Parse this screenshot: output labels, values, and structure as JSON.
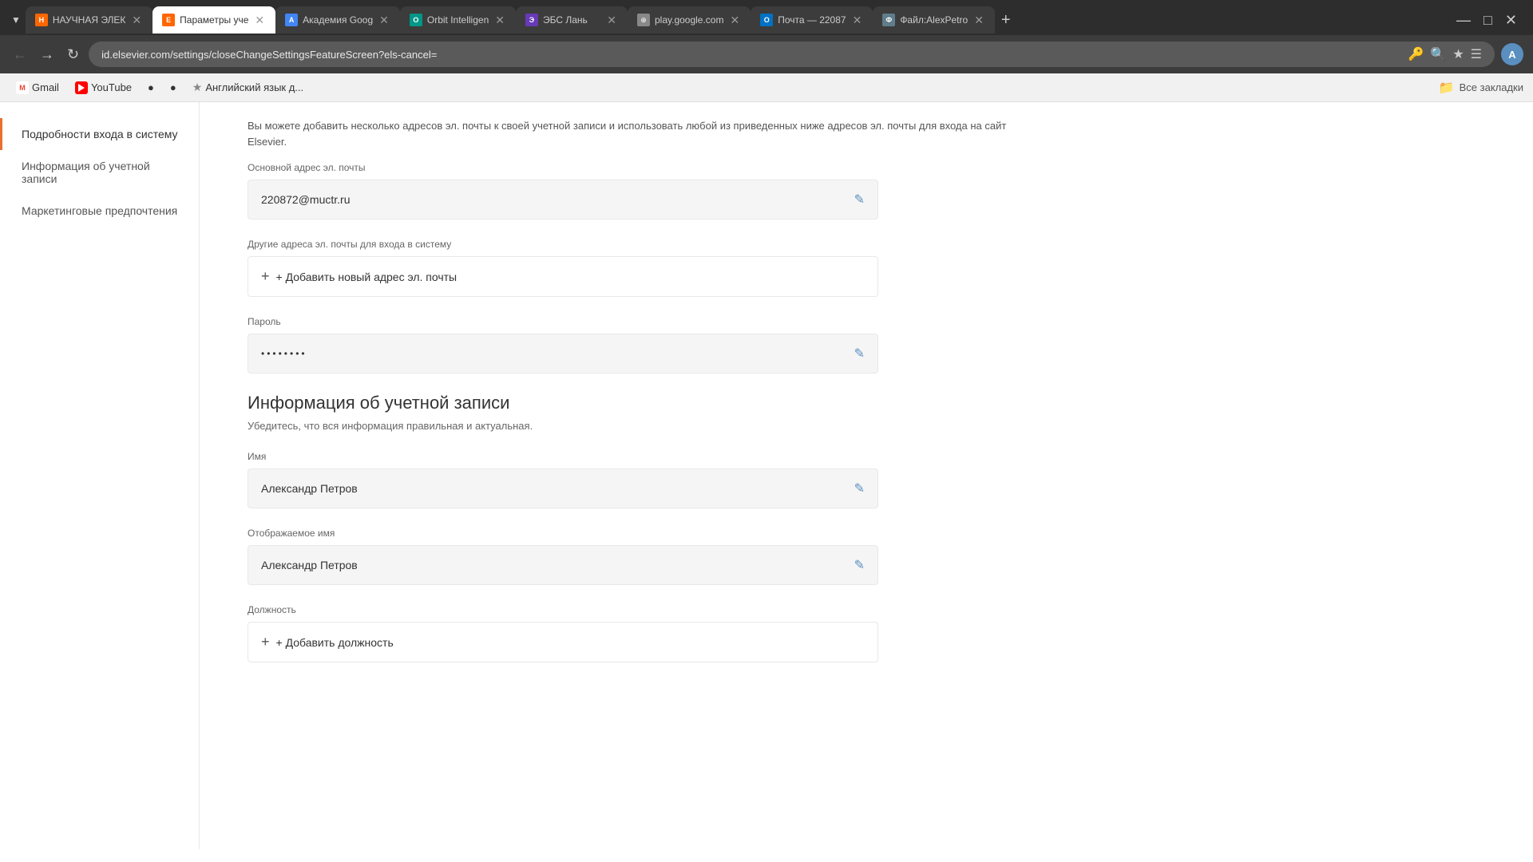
{
  "browser": {
    "tabs": [
      {
        "id": "tab1",
        "label": "НАУЧНАЯ ЭЛЕК",
        "favicon_type": "orange",
        "favicon_text": "Н",
        "active": false,
        "closeable": true
      },
      {
        "id": "tab2",
        "label": "Параметры уче",
        "favicon_type": "elsevier",
        "favicon_text": "E",
        "active": true,
        "closeable": true
      },
      {
        "id": "tab3",
        "label": "Академия Goog",
        "favicon_type": "blue",
        "favicon_text": "A",
        "active": false,
        "closeable": true
      },
      {
        "id": "tab4",
        "label": "Orbit Intelligen",
        "favicon_type": "teal",
        "favicon_text": "O",
        "active": false,
        "closeable": true
      },
      {
        "id": "tab5",
        "label": "ЭБС Лань",
        "favicon_type": "purple",
        "favicon_text": "Э",
        "active": false,
        "closeable": true
      },
      {
        "id": "tab6",
        "label": "play.google.com",
        "favicon_type": "globe",
        "favicon_text": "⊕",
        "active": false,
        "closeable": true
      },
      {
        "id": "tab7",
        "label": "Почта — 22087",
        "favicon_type": "outlook",
        "favicon_text": "O",
        "active": false,
        "closeable": true
      },
      {
        "id": "tab8",
        "label": "Файл:AlexPetro",
        "favicon_type": "file",
        "favicon_text": "Ф",
        "active": false,
        "closeable": true
      }
    ],
    "url": "id.elsevier.com/settings/closeChangeSettingsFeatureScreen?els-cancel=",
    "user_initial": "A"
  },
  "bookmarks": [
    {
      "id": "gmail",
      "type": "gmail",
      "label": "Gmail"
    },
    {
      "id": "youtube",
      "type": "youtube",
      "label": "YouTube"
    },
    {
      "id": "globe1",
      "type": "globe",
      "label": ""
    },
    {
      "id": "globe2",
      "type": "globe",
      "label": ""
    },
    {
      "id": "lang",
      "type": "globe",
      "label": "Английский язык д..."
    }
  ],
  "bookmarks_right_label": "Все закладки",
  "page": {
    "top_info": "Вы можете добавить несколько адресов эл. почты к своей учетной записи и использовать любой из приведенных ниже адресов эл. почты для входа на сайт Elsevier.",
    "top_info_link": "Elsevier",
    "sections": {
      "login_details": {
        "nav_label": "Подробности входа в систему",
        "primary_email_label": "Основной адрес эл. почты",
        "primary_email_value": "220872@muctr.ru",
        "other_emails_label": "Другие адреса эл. почты для входа в систему",
        "add_email_label": "+ Добавить новый адрес эл. почты",
        "password_label": "Пароль",
        "password_value": "••••••••"
      },
      "account_info": {
        "nav_label": "Информация об учетной записи",
        "heading": "Информация об учетной записи",
        "subtext": "Убедитесь, что вся информация правильная и актуальная.",
        "name_label": "Имя",
        "name_value": "Александр Петров",
        "display_name_label": "Отображаемое имя",
        "display_name_value": "Александр Петров",
        "position_label": "Должность",
        "add_position_label": "+ Добавить должность"
      },
      "marketing": {
        "nav_label": "Маркетинговые предпочтения"
      }
    }
  }
}
